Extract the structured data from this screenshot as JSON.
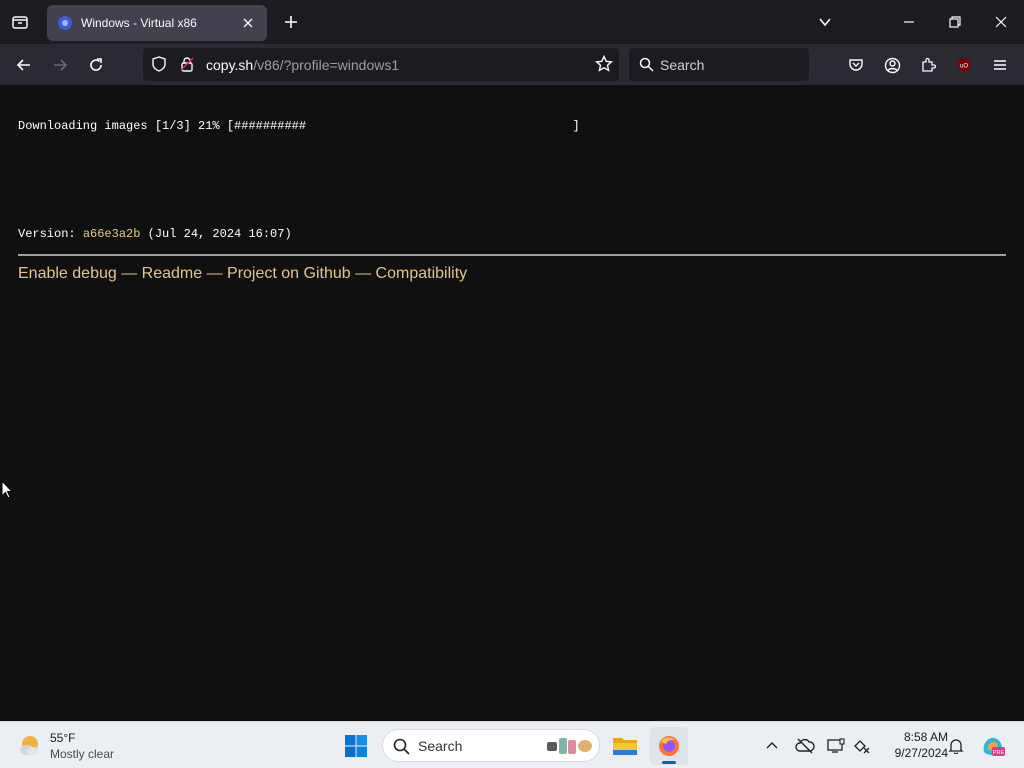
{
  "browser": {
    "tab_title": "Windows - Virtual x86",
    "url_domain": "copy.sh",
    "url_path": "/v86/?profile=windows1",
    "search_placeholder": "Search"
  },
  "page": {
    "progress_text": "Downloading images [1/3] 21% [##########                                     ]",
    "progress_percent": 21,
    "version_label": "Version: ",
    "version_hash": "a66e3a2b",
    "version_date": " (Jul 24, 2024 16:07)",
    "links": [
      "Enable debug",
      "Readme",
      "Project on Github",
      "Compatibility"
    ],
    "separator": " — "
  },
  "taskbar": {
    "weather_temp": "55°F",
    "weather_condition": "Mostly clear",
    "search_placeholder": "Search",
    "time": "8:58 AM",
    "date": "9/27/2024"
  },
  "icons": [
    "tab-list-icon",
    "favicon-icon",
    "close-icon",
    "plus-icon",
    "chevron-down-icon",
    "minimize-icon",
    "restore-icon",
    "back-icon",
    "forward-icon",
    "reload-icon",
    "shield-icon",
    "lock-icon",
    "star-icon",
    "search-icon",
    "pocket-icon",
    "account-icon",
    "extensions-icon",
    "ublock-icon",
    "menu-icon",
    "windows-start-icon",
    "file-explorer-icon",
    "firefox-icon",
    "chevron-up-icon",
    "cloud-offline-icon",
    "display-icon",
    "network-icon",
    "bell-icon",
    "copilot-icon"
  ],
  "colors": {
    "page_bg": "#101010",
    "link": "#e5c48f",
    "hash": "#e5c98a",
    "tab_active": "#42414d",
    "nav_bg": "#2b2a33"
  }
}
